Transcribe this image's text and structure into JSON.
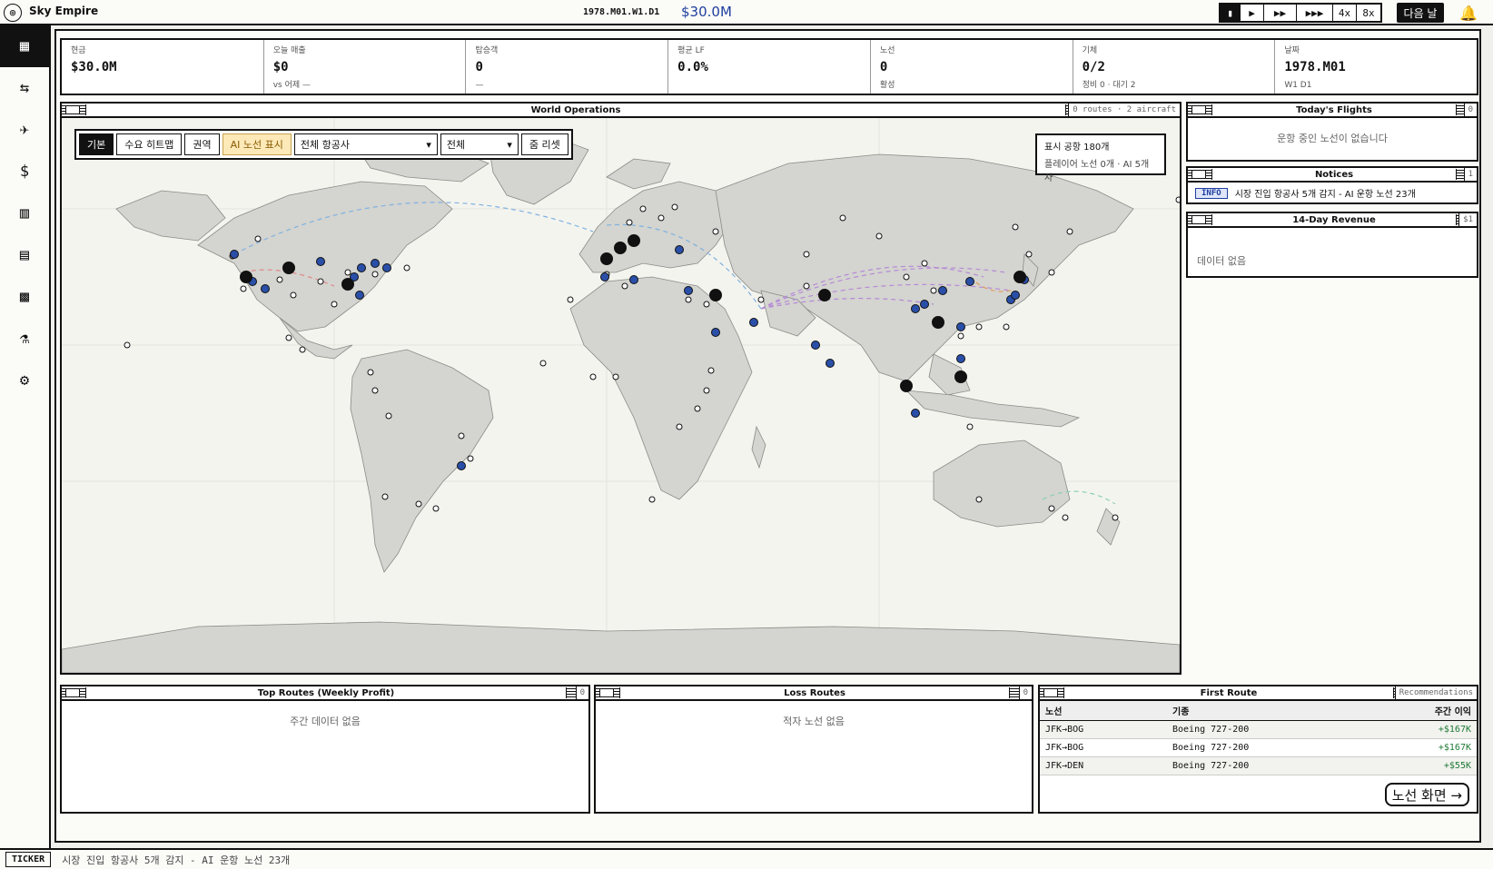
{
  "app": {
    "title": "Sky Empire",
    "date": "1978.M01.W1.D1",
    "cash": "$30.0M"
  },
  "speed": {
    "items": [
      "▮",
      "▶",
      "▶▶",
      "▶▶▶",
      "4x",
      "8x"
    ],
    "next_day": "다음 날"
  },
  "sidebar": {
    "icons": [
      "dashboard-icon",
      "routes-icon",
      "plane-icon",
      "finance-icon",
      "chart-icon",
      "news-icon",
      "building-icon",
      "research-icon",
      "gear-icon"
    ]
  },
  "kpis": [
    {
      "label": "현금",
      "value": "$30.0M",
      "sub": ""
    },
    {
      "label": "오늘 매출",
      "value": "$0",
      "sub": "vs 어제 —"
    },
    {
      "label": "탑승객",
      "value": "0",
      "sub": "—"
    },
    {
      "label": "평균 LF",
      "value": "0.0%",
      "sub": ""
    },
    {
      "label": "노선",
      "value": "0",
      "sub": "활성"
    },
    {
      "label": "기체",
      "value": "0/2",
      "sub": "정비 0 · 대기 2"
    },
    {
      "label": "날짜",
      "value": "1978.M01",
      "sub": "W1 D1"
    }
  ],
  "world": {
    "title": "World Operations",
    "meta": "0 routes · 2 aircraft",
    "controls": {
      "basic": "기본",
      "heatmap": "수요 히트맵",
      "region": "권역",
      "ai_routes": "AI 노선 표시",
      "airline_select": "전체 항공사",
      "filter_select": "전체",
      "zoom_reset": "줌 리셋"
    },
    "info": {
      "airports": "표시 공항 180개",
      "routes": "플레이어 노선 0개 · AI 5개사"
    }
  },
  "flights": {
    "title": "Today's Flights",
    "count": "0",
    "empty": "운항 중인 노선이 없습니다"
  },
  "notices": {
    "title": "Notices",
    "count": "1",
    "badge": "INFO",
    "text": "시장 진입 항공사 5개 감지 - AI 운항 노선 23개"
  },
  "revenue": {
    "title": "14-Day Revenue",
    "meta": "$1",
    "empty": "데이터 없음"
  },
  "top_routes": {
    "title": "Top Routes (Weekly Profit)",
    "count": "0",
    "empty": "주간 데이터 없음"
  },
  "loss_routes": {
    "title": "Loss Routes",
    "count": "0",
    "empty": "적자 노선 없음"
  },
  "first_route": {
    "title": "First Route",
    "meta": "Recommendations",
    "headers": [
      "노선",
      "기종",
      "주간 이익"
    ],
    "rows": [
      {
        "route": "JFK→BOG",
        "type": "Boeing 727-200",
        "profit": "+$167K"
      },
      {
        "route": "JFK→BOG",
        "type": "Boeing 727-200",
        "profit": "+$167K"
      },
      {
        "route": "JFK→DEN",
        "type": "Boeing 727-200",
        "profit": "+$55K"
      }
    ],
    "button": "노선 화면 →"
  },
  "ticker": {
    "label": "TICKER",
    "text": "시장 진입 항공사 5개 감지 - AI 운항 노선 23개"
  }
}
